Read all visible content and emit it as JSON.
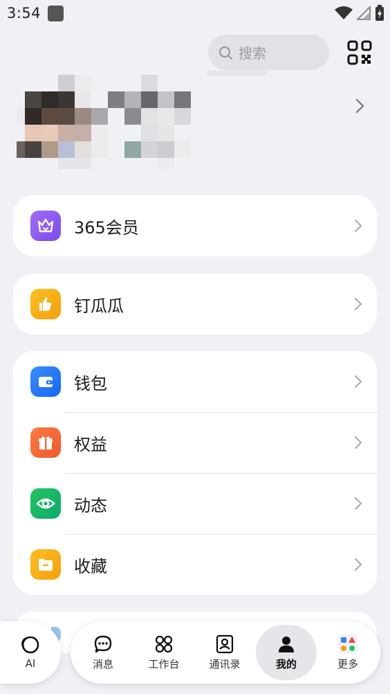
{
  "status_bar": {
    "time": "3:54"
  },
  "header": {
    "search_placeholder": "搜索"
  },
  "menu": {
    "card1": [
      {
        "label": "365会员",
        "icon": "crown-icon",
        "color": "#8b5cf6"
      }
    ],
    "card2": [
      {
        "label": "钉瓜瓜",
        "icon": "thumbs-up-icon",
        "color": "#f59e0b"
      }
    ],
    "card3": [
      {
        "label": "钱包",
        "icon": "wallet-icon",
        "color": "#1e7bff"
      },
      {
        "label": "权益",
        "icon": "gift-icon",
        "color": "#f26a3a"
      },
      {
        "label": "动态",
        "icon": "eye-icon",
        "color": "#10b981"
      },
      {
        "label": "收藏",
        "icon": "folder-icon",
        "color": "#f7a90e"
      }
    ]
  },
  "ai_button": {
    "label": "AI"
  },
  "tabbar": {
    "tabs": [
      {
        "label": "消息",
        "icon": "chat-bubble-icon"
      },
      {
        "label": "工作台",
        "icon": "grid-icon"
      },
      {
        "label": "通讯录",
        "icon": "contact-card-icon"
      },
      {
        "label": "我的",
        "icon": "person-icon",
        "active": true
      },
      {
        "label": "更多",
        "icon": "more-apps-icon"
      }
    ]
  }
}
